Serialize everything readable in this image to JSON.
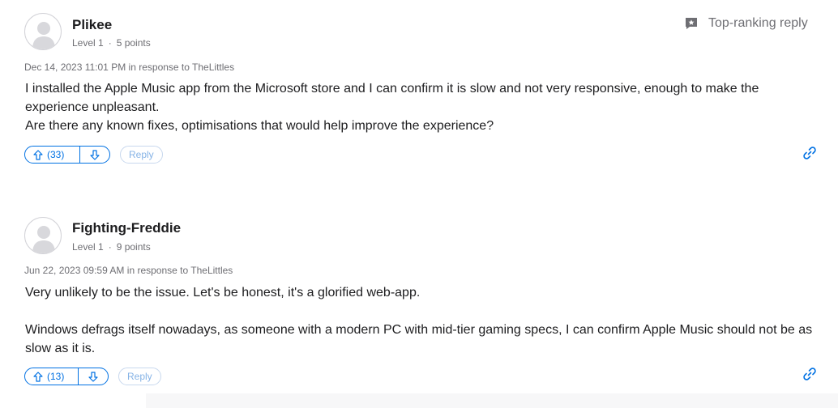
{
  "posts": [
    {
      "username": "Plikee",
      "level": "Level 1",
      "points": "5 points",
      "date": "Dec 14, 2023 11:01 PM",
      "in_response_to": "in response to TheLittles",
      "badge": "Top-ranking reply",
      "body_lines": [
        "I installed the Apple Music app from the Microsoft store and I can confirm it is slow and not very responsive, enough to make the experience unpleasant.",
        "Are there any known fixes, optimisations that would help improve the experience?"
      ],
      "upvotes": "(33)",
      "reply_label": "Reply"
    },
    {
      "username": "Fighting-Freddie",
      "level": "Level 1",
      "points": "9 points",
      "date": "Jun 22, 2023 09:59 AM",
      "in_response_to": "in response to TheLittles",
      "body_lines": [
        "Very unlikely to be the issue. Let's be honest, it's a glorified web-app.",
        "Windows defrags itself nowadays, as someone with a modern PC with mid-tier gaming specs, I can confirm Apple Music should not be as slow as it is."
      ],
      "upvotes": "(13)",
      "reply_label": "Reply"
    }
  ],
  "colors": {
    "accent": "#0071e3",
    "muted_text": "#6e6e73",
    "text": "#1d1d1f"
  },
  "icons": {
    "avatar": "user-silhouette-icon",
    "badge": "star-speech-bubble-icon",
    "upvote": "arrow-up-icon",
    "downvote": "arrow-down-icon",
    "permalink": "chain-link-icon"
  }
}
